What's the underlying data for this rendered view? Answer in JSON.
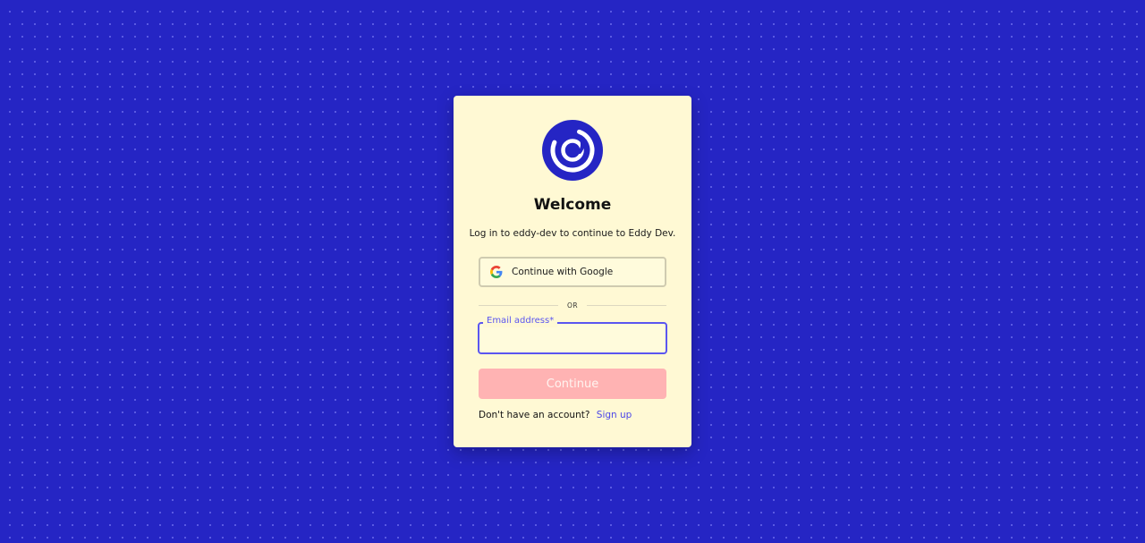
{
  "colors": {
    "background": "#2525c4",
    "card": "#fff9d4",
    "accent": "#5b56f0",
    "link": "#4c47e8",
    "continue_button": "#ffb3b3"
  },
  "logo": {
    "icon": "eddy-logo-icon"
  },
  "welcome": {
    "title": "Welcome",
    "subtitle": "Log in to eddy-dev to continue to Eddy Dev."
  },
  "google_button": {
    "label": "Continue with Google",
    "icon": "google-icon"
  },
  "divider": {
    "text": "OR"
  },
  "email": {
    "label": "Email address*",
    "value": "",
    "placeholder": ""
  },
  "continue_button": {
    "label": "Continue"
  },
  "signup": {
    "prompt": "Don't have an account?",
    "link_label": "Sign up"
  }
}
